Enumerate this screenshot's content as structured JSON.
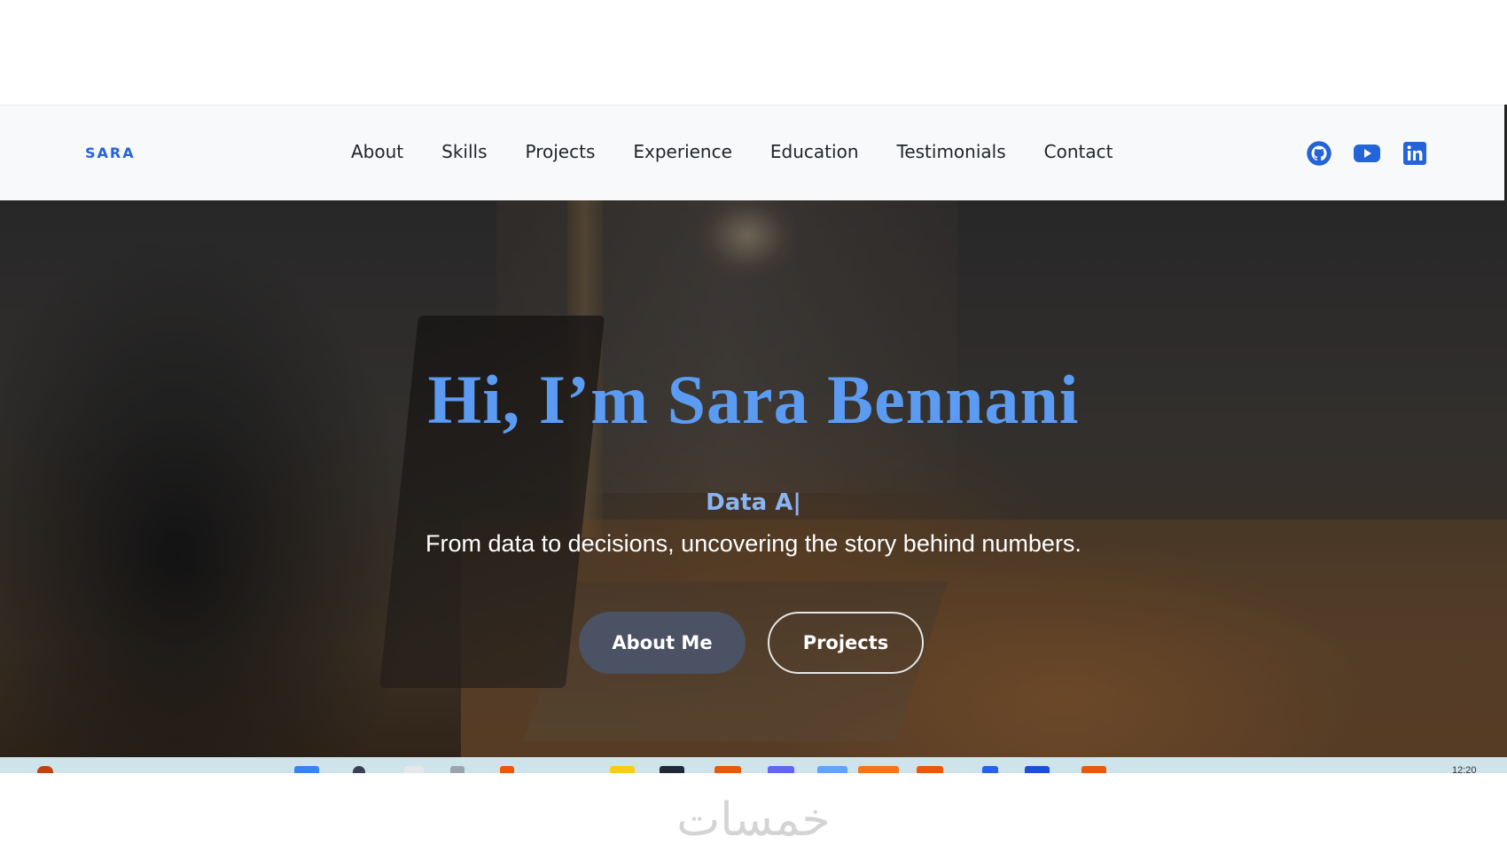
{
  "header": {
    "brand": "SARA",
    "nav": [
      "About",
      "Skills",
      "Projects",
      "Experience",
      "Education",
      "Testimonials",
      "Contact"
    ],
    "social_icons": [
      "github-icon",
      "youtube-icon",
      "linkedin-icon"
    ]
  },
  "hero": {
    "title": "Hi, I’m Sara Bennani",
    "typed_text": "Data A|",
    "tagline": "From data to decisions, uncovering the story behind numbers.",
    "primary_button": "About Me",
    "secondary_button": "Projects"
  },
  "taskbar": {
    "time": "12:20"
  },
  "watermark": "خمسات",
  "colors": {
    "brand": "#2563d8",
    "title": "#5b9bf2",
    "typed": "#8ab4f2",
    "primary_button": "#4a5263"
  }
}
